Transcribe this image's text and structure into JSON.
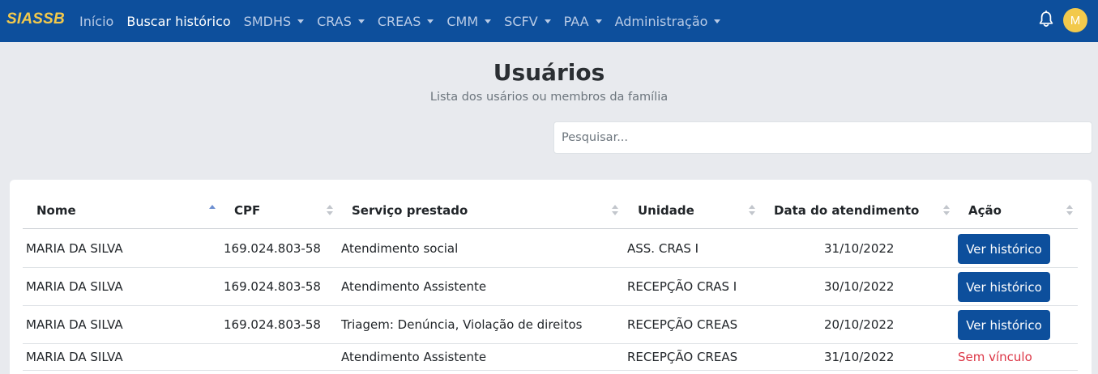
{
  "navbar": {
    "brand": "SIASSB",
    "items": [
      {
        "label": "Início",
        "dropdown": false,
        "active": false
      },
      {
        "label": "Buscar histórico",
        "dropdown": false,
        "active": true
      },
      {
        "label": "SMDHS",
        "dropdown": true,
        "active": false
      },
      {
        "label": "CRAS",
        "dropdown": true,
        "active": false
      },
      {
        "label": "CREAS",
        "dropdown": true,
        "active": false
      },
      {
        "label": "CMM",
        "dropdown": true,
        "active": false
      },
      {
        "label": "SCFV",
        "dropdown": true,
        "active": false
      },
      {
        "label": "PAA",
        "dropdown": true,
        "active": false
      },
      {
        "label": "Administração",
        "dropdown": true,
        "active": false
      }
    ],
    "notification_icon": "bell-icon",
    "avatar_initial": "M",
    "colors": {
      "background": "#0d4f9c",
      "brand": "#f2c94c",
      "avatar": "#f2c94c"
    }
  },
  "page": {
    "title": "Usuários",
    "subtitle": "Lista dos usários ou membros da família"
  },
  "search": {
    "placeholder": "Pesquisar...",
    "value": ""
  },
  "table": {
    "columns": [
      {
        "label": "Nome",
        "sort": "asc"
      },
      {
        "label": "CPF",
        "sort": "none"
      },
      {
        "label": "Serviço prestado",
        "sort": "none"
      },
      {
        "label": "Unidade",
        "sort": "none"
      },
      {
        "label": "Data do atendimento",
        "sort": "none"
      },
      {
        "label": "Ação",
        "sort": "none"
      }
    ],
    "rows": [
      {
        "nome": "MARIA DA SILVA",
        "cpf": "169.024.803-58",
        "servico": "Atendimento social",
        "unidade": "ASS. CRAS I",
        "data": "31/10/2022",
        "acao": "Ver histórico",
        "acao_type": "button"
      },
      {
        "nome": "MARIA DA SILVA",
        "cpf": "169.024.803-58",
        "servico": "Atendimento Assistente",
        "unidade": "RECEPÇÃO CRAS I",
        "data": "30/10/2022",
        "acao": "Ver histórico",
        "acao_type": "button"
      },
      {
        "nome": "MARIA DA SILVA",
        "cpf": "169.024.803-58",
        "servico": "Triagem: Denúncia, Violação de direitos",
        "unidade": "RECEPÇÃO CREAS",
        "data": "20/10/2022",
        "acao": "Ver histórico",
        "acao_type": "button"
      },
      {
        "nome": "MARIA DA SILVA",
        "cpf": "",
        "servico": "Atendimento Assistente",
        "unidade": "RECEPÇÃO CREAS",
        "data": "31/10/2022",
        "acao": "Sem vínculo",
        "acao_type": "text"
      }
    ],
    "colors": {
      "button": "#0d4f9c",
      "no_link": "#dc3545"
    }
  }
}
